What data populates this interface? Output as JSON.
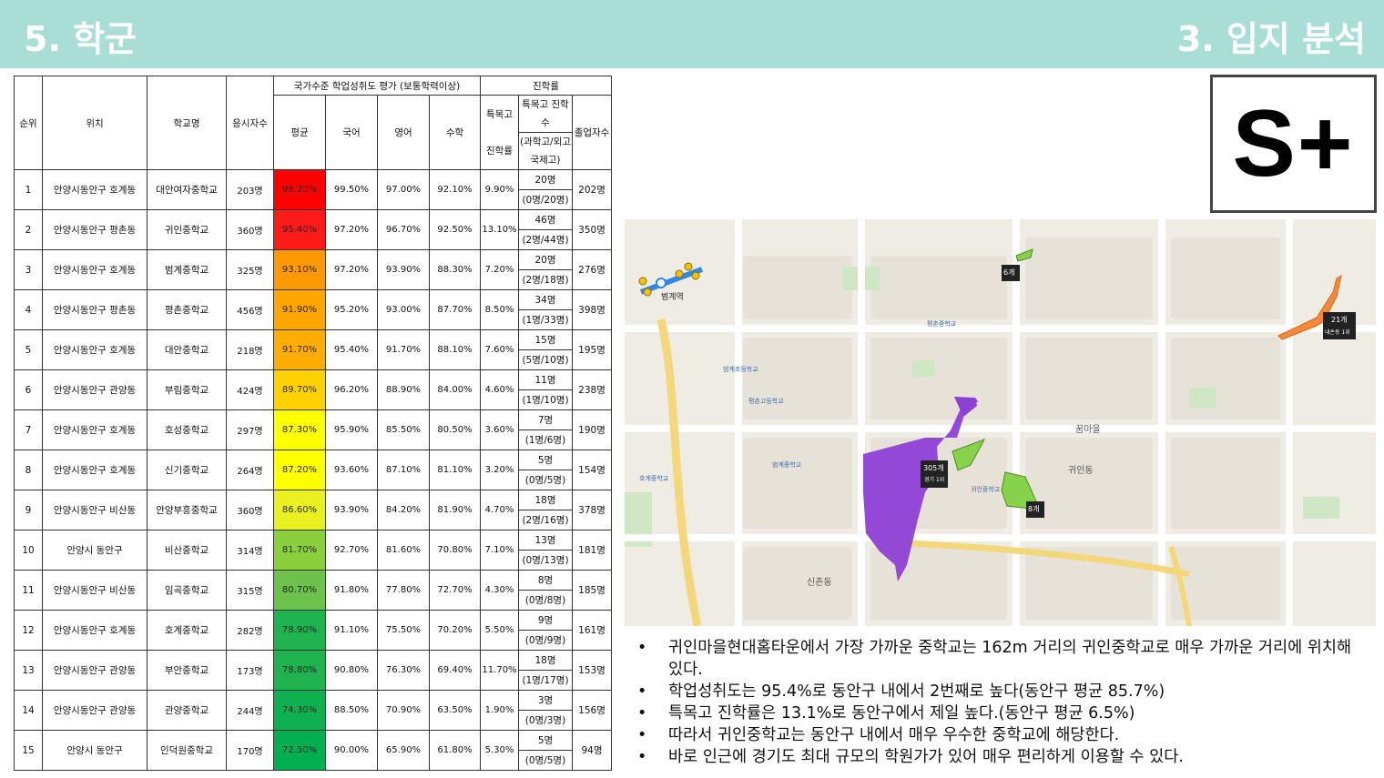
{
  "header": {
    "left_title": "5. 학군",
    "right_title": "3. 입지 분석"
  },
  "grade": "S+",
  "table": {
    "headers": {
      "rank": "순위",
      "location": "위치",
      "school": "학교명",
      "applicants": "응시자수",
      "assessment_group": "국가수준 학업성취도 평가 (보통학력이상)",
      "avg": "평균",
      "korean": "국어",
      "english": "영어",
      "math": "수학",
      "advancement_group": "진학률",
      "special_rate_1": "특목고",
      "special_rate_2": "진학률",
      "special_count_1": "특목고 진학수",
      "special_count_2": "(과학고/외고국제고)",
      "graduates": "졸업자수"
    },
    "rows": [
      {
        "rank": "1",
        "location": "안양시동안구 호계동",
        "school": "대안여자중학교",
        "applicants": "203명",
        "avg": "96.20%",
        "avg_color": "#ff0000",
        "korean": "99.50%",
        "english": "97.00%",
        "math": "92.10%",
        "special_rate": "9.90%",
        "special_count": "20명",
        "special_detail": "(0명/20명)",
        "graduates": "202명"
      },
      {
        "rank": "2",
        "location": "안양시동안구 평촌동",
        "school": "귀인중학교",
        "applicants": "360명",
        "avg": "95.40%",
        "avg_color": "#ff1a1a",
        "korean": "97.20%",
        "english": "96.70%",
        "math": "92.50%",
        "special_rate": "13.10%",
        "special_count": "46명",
        "special_detail": "(2명/44명)",
        "graduates": "350명"
      },
      {
        "rank": "3",
        "location": "안양시동안구 호계동",
        "school": "범계중학교",
        "applicants": "325명",
        "avg": "93.10%",
        "avg_color": "#ff9900",
        "korean": "97.20%",
        "english": "93.90%",
        "math": "88.30%",
        "special_rate": "7.20%",
        "special_count": "20명",
        "special_detail": "(2명/18명)",
        "graduates": "276명"
      },
      {
        "rank": "4",
        "location": "안양시동안구 평촌동",
        "school": "평촌중학교",
        "applicants": "456명",
        "avg": "91.90%",
        "avg_color": "#ffa500",
        "korean": "95.20%",
        "english": "93.00%",
        "math": "87.70%",
        "special_rate": "8.50%",
        "special_count": "34명",
        "special_detail": "(1명/33명)",
        "graduates": "398명"
      },
      {
        "rank": "5",
        "location": "안양시동안구 호계동",
        "school": "대안중학교",
        "applicants": "218명",
        "avg": "91.70%",
        "avg_color": "#ffae00",
        "korean": "95.40%",
        "english": "91.70%",
        "math": "88.10%",
        "special_rate": "7.60%",
        "special_count": "15명",
        "special_detail": "(5명/10명)",
        "graduates": "195명"
      },
      {
        "rank": "6",
        "location": "안양시동안구 관양동",
        "school": "부림중학교",
        "applicants": "424명",
        "avg": "89.70%",
        "avg_color": "#ffd200",
        "korean": "96.20%",
        "english": "88.90%",
        "math": "84.00%",
        "special_rate": "4.60%",
        "special_count": "11명",
        "special_detail": "(1명/10명)",
        "graduates": "238명"
      },
      {
        "rank": "7",
        "location": "안양시동안구 호계동",
        "school": "호성중학교",
        "applicants": "297명",
        "avg": "87.30%",
        "avg_color": "#ffff00",
        "korean": "95.90%",
        "english": "85.50%",
        "math": "80.50%",
        "special_rate": "3.60%",
        "special_count": "7명",
        "special_detail": "(1명/6명)",
        "graduates": "190명"
      },
      {
        "rank": "8",
        "location": "안양시동안구 호계동",
        "school": "신기중학교",
        "applicants": "264명",
        "avg": "87.20%",
        "avg_color": "#ffff00",
        "korean": "93.60%",
        "english": "87.10%",
        "math": "81.10%",
        "special_rate": "3.20%",
        "special_count": "5명",
        "special_detail": "(0명/5명)",
        "graduates": "154명"
      },
      {
        "rank": "9",
        "location": "안양시동안구 비산동",
        "school": "안양부흥중학교",
        "applicants": "360명",
        "avg": "86.60%",
        "avg_color": "#e9f21e",
        "korean": "93.90%",
        "english": "84.20%",
        "math": "81.90%",
        "special_rate": "4.70%",
        "special_count": "18명",
        "special_detail": "(2명/16명)",
        "graduates": "378명"
      },
      {
        "rank": "10",
        "location": "안양시 동안구",
        "school": "비산중학교",
        "applicants": "314명",
        "avg": "81.70%",
        "avg_color": "#8ccf3c",
        "korean": "92.70%",
        "english": "81.60%",
        "math": "70.80%",
        "special_rate": "7.10%",
        "special_count": "13명",
        "special_detail": "(0명/13명)",
        "graduates": "181명"
      },
      {
        "rank": "11",
        "location": "안양시동안구 비산동",
        "school": "임곡중학교",
        "applicants": "315명",
        "avg": "80.70%",
        "avg_color": "#6cc24a",
        "korean": "91.80%",
        "english": "77.80%",
        "math": "72.70%",
        "special_rate": "4.30%",
        "special_count": "8명",
        "special_detail": "(0명/8명)",
        "graduates": "185명"
      },
      {
        "rank": "12",
        "location": "안양시동안구 호계동",
        "school": "호계중학교",
        "applicants": "282명",
        "avg": "78.90%",
        "avg_color": "#1fb350",
        "korean": "91.10%",
        "english": "75.50%",
        "math": "70.20%",
        "special_rate": "5.50%",
        "special_count": "9명",
        "special_detail": "(0명/9명)",
        "graduates": "161명"
      },
      {
        "rank": "13",
        "location": "안양시동안구 관양동",
        "school": "부안중학교",
        "applicants": "173명",
        "avg": "78.80%",
        "avg_color": "#1fb350",
        "korean": "90.80%",
        "english": "76.30%",
        "math": "69.40%",
        "special_rate": "11.70%",
        "special_count": "18명",
        "special_detail": "(1명/17명)",
        "graduates": "153명"
      },
      {
        "rank": "14",
        "location": "안양시동안구 관양동",
        "school": "관양중학교",
        "applicants": "244명",
        "avg": "74.30%",
        "avg_color": "#0fb04f",
        "korean": "88.50%",
        "english": "70.90%",
        "math": "63.50%",
        "special_rate": "1.90%",
        "special_count": "3명",
        "special_detail": "(0명/3명)",
        "graduates": "156명"
      },
      {
        "rank": "15",
        "location": "안양시 동안구",
        "school": "인덕원중학교",
        "applicants": "170명",
        "avg": "72.50%",
        "avg_color": "#00b050",
        "korean": "90.00%",
        "english": "65.90%",
        "math": "61.80%",
        "special_rate": "5.30%",
        "special_count": "5명",
        "special_detail": "(0명/5명)",
        "graduates": "94명"
      }
    ]
  },
  "map": {
    "labels": {
      "beomgye_station": "범계역",
      "purple_count": "305개",
      "purple_sub": "경기 1위",
      "green_top": "6개",
      "green_mid": "8개",
      "orange_count": "21개",
      "orange_sub": "내손동 1위",
      "gwiin_dong": "귀인동",
      "kkummaeul": "꿈마을",
      "pyeongchon_middle": "평촌중학교",
      "beomgye_middle": "범계중학교",
      "gwiin_middle": "귀인중학교",
      "pyeongchon_high": "평촌고등학교",
      "beomgye_elementary": "범계초등학교",
      "hogye_middle": "호계중학교",
      "sincheon": "신촌동"
    },
    "colors": {
      "purple": "#8e3fd6",
      "green": "#86d24a",
      "orange": "#f5883a",
      "road": "#ffffff",
      "park": "#cfe7c2"
    }
  },
  "notes": [
    "귀인마을현대홈타운에서 가장 가까운 중학교는 162m 거리의 귀인중학교로 매우 가까운 거리에 위치해 있다.",
    "학업성취도는 95.4%로 동안구 내에서 2번째로 높다(동안구 평균 85.7%)",
    "특목고 진학률은 13.1%로 동안구에서 제일 높다.(동안구 평균 6.5%)",
    "따라서 귀인중학교는 동안구 내에서 매우 우수한 중학교에 해당한다.",
    "바로 인근에 경기도 최대 규모의 학원가가 있어 매우 편리하게 이용할 수 있다."
  ]
}
